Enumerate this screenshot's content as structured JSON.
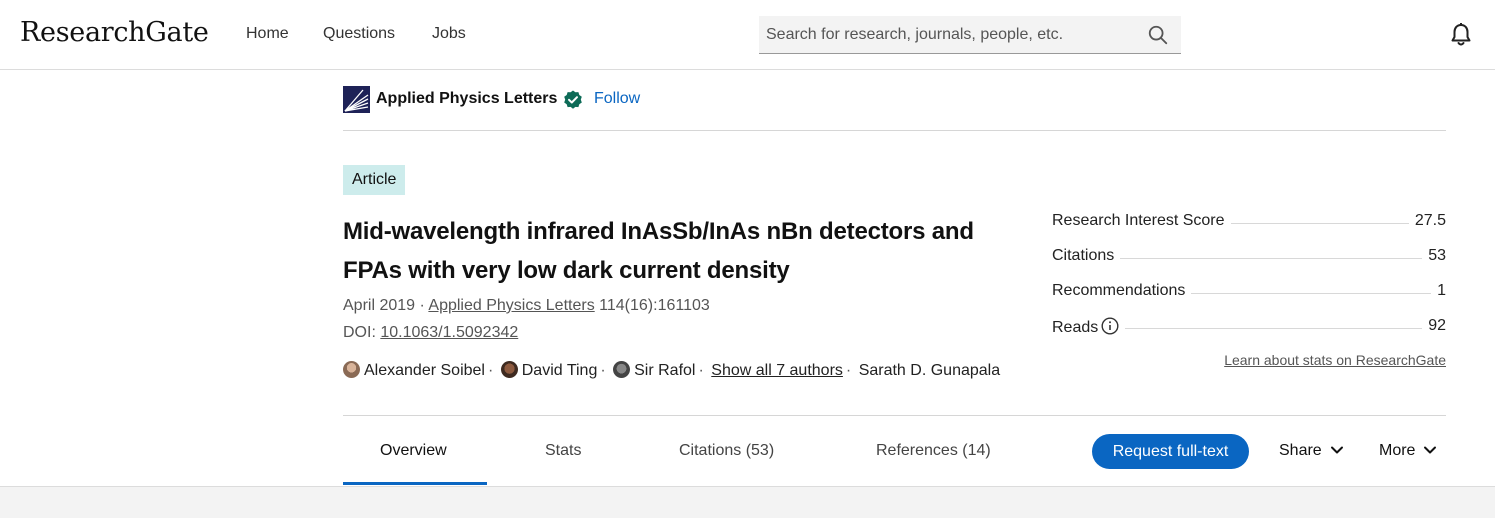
{
  "header": {
    "logo": "ResearchGate",
    "nav": [
      "Home",
      "Questions",
      "Jobs"
    ],
    "search_placeholder": "Search for research, journals, people, etc."
  },
  "journal": {
    "name": "Applied Physics Letters",
    "follow_label": "Follow"
  },
  "article": {
    "type_badge": "Article",
    "title": "Mid-wavelength infrared InAsSb/InAs nBn detectors and FPAs with very low dark current density",
    "date": "April 2019",
    "journal_link": "Applied Physics Letters",
    "volume": "114(16):161103",
    "doi_label": "DOI:",
    "doi": "10.1063/1.5092342",
    "authors": [
      {
        "name": "Alexander Soibel",
        "avatar_color": "#8a6a55"
      },
      {
        "name": "David Ting",
        "avatar_color": "#5b3a2a"
      },
      {
        "name": "Sir Rafol",
        "avatar_color": "#555555"
      }
    ],
    "show_all_authors": "Show all 7 authors",
    "last_author": "Sarath D. Gunapala"
  },
  "stats": [
    {
      "label": "Research Interest Score",
      "value": "27.5"
    },
    {
      "label": "Citations",
      "value": "53"
    },
    {
      "label": "Recommendations",
      "value": "1"
    },
    {
      "label": "Reads",
      "value": "92"
    }
  ],
  "learn_link": "Learn about stats on ResearchGate",
  "tabs": [
    "Overview",
    "Stats",
    "Citations (53)",
    "References (14)"
  ],
  "actions": {
    "request": "Request full-text",
    "share": "Share",
    "more": "More"
  },
  "colors": {
    "accent": "#0a66c2",
    "badge_bg": "#cdecec",
    "verified": "#0d6b57",
    "journal_logo_bg": "#1e2257"
  }
}
